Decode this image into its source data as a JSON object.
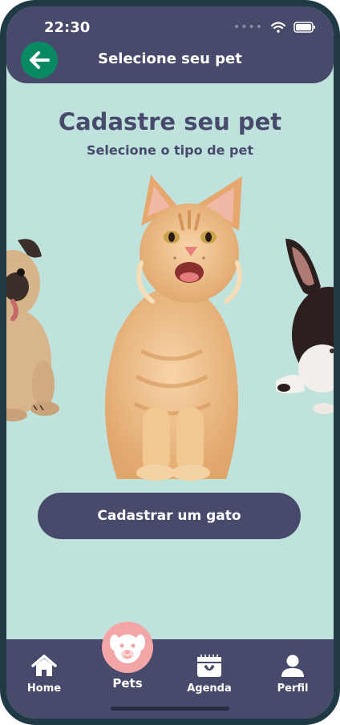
{
  "status_bar": {
    "time": "22:30"
  },
  "header": {
    "title": "Selecione seu pet"
  },
  "main": {
    "title": "Cadastre seu pet",
    "subtitle": "Selecione o tipo de pet",
    "carousel": [
      "dog-image",
      "cat-image",
      "rabbit-image"
    ],
    "cta_label": "Cadastrar um gato"
  },
  "nav": {
    "items": [
      {
        "label": "Home",
        "icon": "home-icon"
      },
      {
        "label": "Pets",
        "icon": "dog-face-icon"
      },
      {
        "label": "Agenda",
        "icon": "calendar-icon"
      },
      {
        "label": "Perfil",
        "icon": "user-icon"
      }
    ]
  },
  "colors": {
    "background": "#bfe2dd",
    "primary": "#474a6b",
    "back_button": "#0a8a63",
    "pets_bubble": "#f4a6a6"
  }
}
